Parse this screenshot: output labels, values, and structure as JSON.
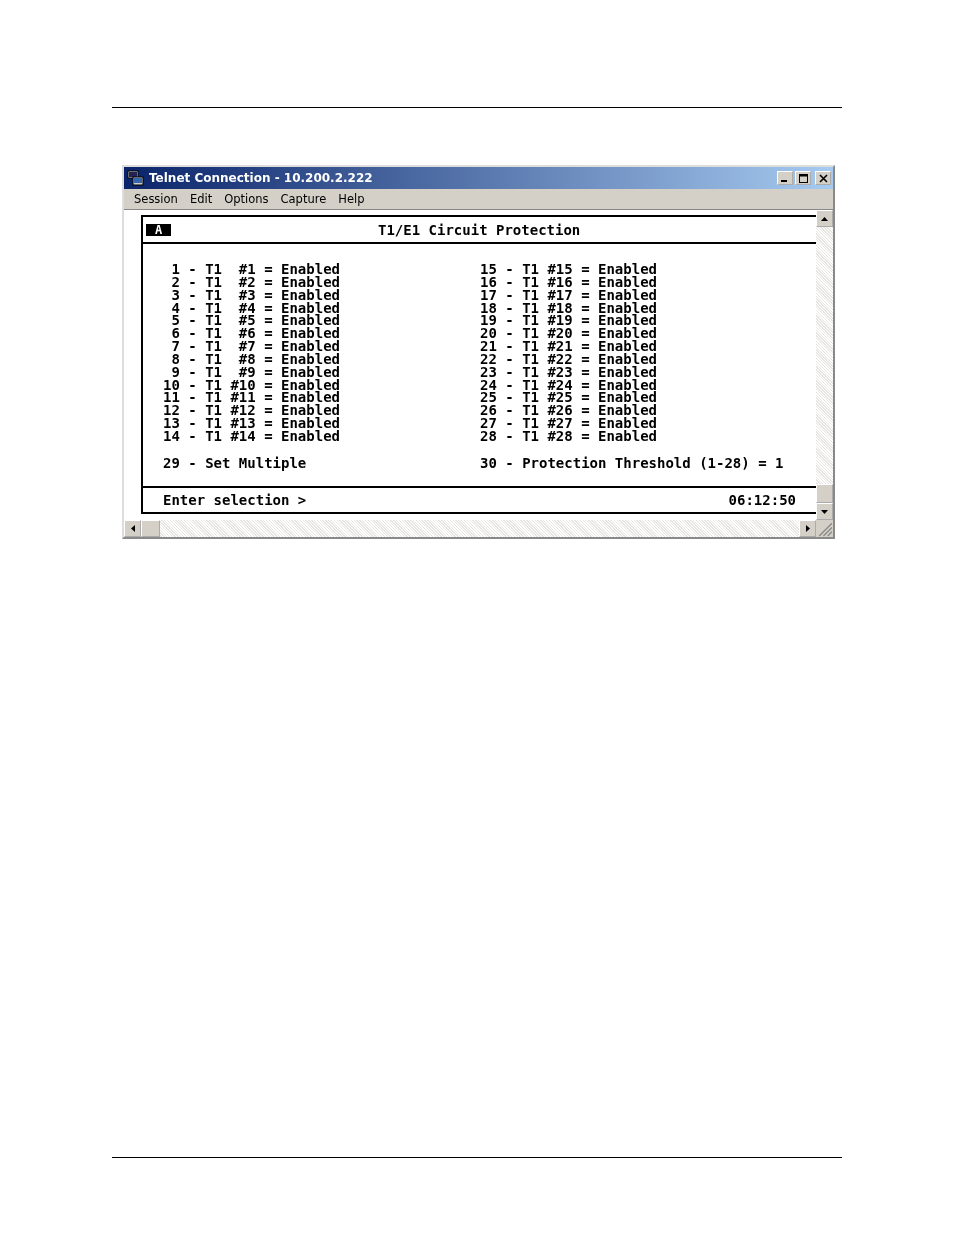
{
  "window": {
    "title": "Telnet Connection - 10.200.2.222"
  },
  "menu": [
    {
      "label": "Session"
    },
    {
      "label": "Edit"
    },
    {
      "label": "Options"
    },
    {
      "label": "Capture"
    },
    {
      "label": "Help"
    }
  ],
  "terminal": {
    "tag": "A",
    "title": "T1/E1 Circuit Protection",
    "left_entries": [
      " 1 - T1  #1 = Enabled",
      " 2 - T1  #2 = Enabled",
      " 3 - T1  #3 = Enabled",
      " 4 - T1  #4 = Enabled",
      " 5 - T1  #5 = Enabled",
      " 6 - T1  #6 = Enabled",
      " 7 - T1  #7 = Enabled",
      " 8 - T1  #8 = Enabled",
      " 9 - T1  #9 = Enabled",
      "10 - T1 #10 = Enabled",
      "11 - T1 #11 = Enabled",
      "12 - T1 #12 = Enabled",
      "13 - T1 #13 = Enabled",
      "14 - T1 #14 = Enabled"
    ],
    "right_entries": [
      "15 - T1 #15 = Enabled",
      "16 - T1 #16 = Enabled",
      "17 - T1 #17 = Enabled",
      "18 - T1 #18 = Enabled",
      "19 - T1 #19 = Enabled",
      "20 - T1 #20 = Enabled",
      "21 - T1 #21 = Enabled",
      "22 - T1 #22 = Enabled",
      "23 - T1 #23 = Enabled",
      "24 - T1 #24 = Enabled",
      "25 - T1 #25 = Enabled",
      "26 - T1 #26 = Enabled",
      "27 - T1 #27 = Enabled",
      "28 - T1 #28 = Enabled"
    ],
    "left_option": "29 - Set Multiple",
    "right_option": "30 - Protection Threshold (1-28) = 1",
    "prompt": "Enter selection >",
    "time": "06:12:50"
  }
}
